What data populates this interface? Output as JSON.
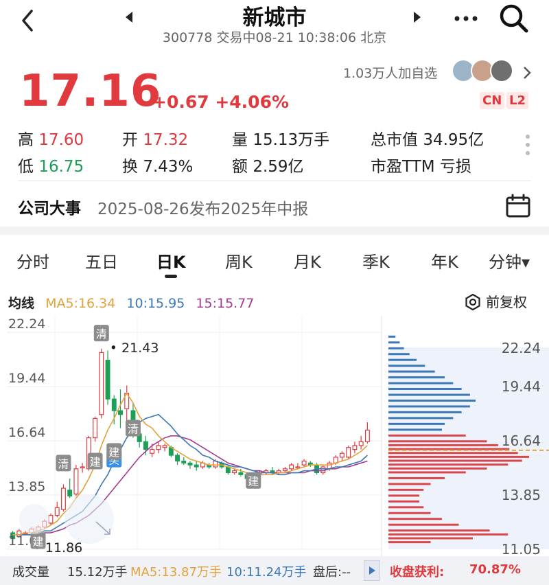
{
  "header": {
    "title": "新城市",
    "subtitle": "300778 交易中08-21 10:38:06 北京"
  },
  "quote": {
    "price": "17.16",
    "change": "+0.67 +4.06%",
    "followers": "1.03万人加自选",
    "tag_cn": "CN",
    "tag_l2": "L2"
  },
  "stats": {
    "high_label": "高",
    "high": "17.60",
    "open_label": "开",
    "open": "17.32",
    "vol_label": "量",
    "vol": "15.13万手",
    "mcap_label": "总市值",
    "mcap": "34.95亿",
    "low_label": "低",
    "low": "16.75",
    "turn_label": "换",
    "turn": "7.43%",
    "amt_label": "额",
    "amt": "2.59亿",
    "pe_label": "市盈TTM",
    "pe": "亏损"
  },
  "event": {
    "label": "公司大事",
    "text": "2025-08-26发布2025年中报"
  },
  "tabs": [
    "分时",
    "五日",
    "日K",
    "周K",
    "月K",
    "季K",
    "年K",
    "分钟▾"
  ],
  "active_tab": "日K",
  "ma": {
    "label": "均线",
    "ma5": "MA5:16.34",
    "ma10": "10:15.95",
    "ma15": "15:15.77",
    "fq_label": "前复权"
  },
  "colors": {
    "up": "#e0393e",
    "down": "#1c9f56",
    "ma5": "#e2a23b",
    "ma10": "#3b78b7",
    "ma15": "#a33a8f",
    "profile_up": "#d9464b",
    "profile_down": "#3b78b7"
  },
  "chart_data": {
    "type": "candlestick",
    "y_ticks_left": [
      "22.24",
      "19.44",
      "16.64",
      "13.85",
      "11.05"
    ],
    "y_ticks_right": [
      "22.24",
      "19.44",
      "16.64",
      "13.85",
      "11.05"
    ],
    "ylim": [
      11.05,
      22.24
    ],
    "max_label": "21.43",
    "min_label": "11.86",
    "markers": [
      "清",
      "建",
      "清",
      "建",
      "买",
      "清",
      "建",
      "建"
    ],
    "candles": [
      {
        "o": 11.9,
        "c": 11.6,
        "h": 12.0,
        "l": 11.4
      },
      {
        "o": 11.7,
        "c": 12.0,
        "h": 12.1,
        "l": 11.7
      },
      {
        "o": 11.9,
        "c": 11.9,
        "h": 12.0,
        "l": 11.8
      },
      {
        "o": 11.9,
        "c": 12.1,
        "h": 12.2,
        "l": 11.8
      },
      {
        "o": 12.0,
        "c": 12.2,
        "h": 12.3,
        "l": 11.9
      },
      {
        "o": 12.2,
        "c": 12.5,
        "h": 12.6,
        "l": 12.1
      },
      {
        "o": 12.4,
        "c": 12.8,
        "h": 12.9,
        "l": 12.3
      },
      {
        "o": 12.8,
        "c": 13.2,
        "h": 13.5,
        "l": 12.7
      },
      {
        "o": 13.1,
        "c": 14.2,
        "h": 14.4,
        "l": 13.0
      },
      {
        "o": 14.1,
        "c": 13.8,
        "h": 14.7,
        "l": 13.7
      },
      {
        "o": 13.9,
        "c": 15.2,
        "h": 15.4,
        "l": 13.8
      },
      {
        "o": 15.3,
        "c": 15.3,
        "h": 15.5,
        "l": 15.0
      },
      {
        "o": 15.2,
        "c": 16.8,
        "h": 16.9,
        "l": 15.1
      },
      {
        "o": 16.8,
        "c": 17.8,
        "h": 17.9,
        "l": 16.6
      },
      {
        "o": 18.0,
        "c": 21.2,
        "h": 21.4,
        "l": 17.8
      },
      {
        "o": 20.8,
        "c": 18.8,
        "h": 21.3,
        "l": 18.5
      },
      {
        "o": 18.8,
        "c": 18.2,
        "h": 19.0,
        "l": 17.5
      },
      {
        "o": 18.2,
        "c": 18.0,
        "h": 19.3,
        "l": 17.3
      },
      {
        "o": 18.3,
        "c": 19.1,
        "h": 19.5,
        "l": 17.5
      },
      {
        "o": 18.2,
        "c": 17.3,
        "h": 18.6,
        "l": 16.8
      },
      {
        "o": 17.0,
        "c": 16.6,
        "h": 17.5,
        "l": 16.3
      },
      {
        "o": 16.6,
        "c": 16.2,
        "h": 16.9,
        "l": 15.9
      },
      {
        "o": 16.0,
        "c": 16.2,
        "h": 16.5,
        "l": 15.8
      },
      {
        "o": 16.2,
        "c": 16.4,
        "h": 16.6,
        "l": 16.0
      },
      {
        "o": 16.3,
        "c": 16.4,
        "h": 16.5,
        "l": 16.1
      },
      {
        "o": 16.3,
        "c": 15.9,
        "h": 16.4,
        "l": 15.8
      },
      {
        "o": 15.9,
        "c": 15.6,
        "h": 16.0,
        "l": 15.4
      },
      {
        "o": 15.6,
        "c": 15.5,
        "h": 15.8,
        "l": 15.4
      },
      {
        "o": 15.5,
        "c": 15.4,
        "h": 15.6,
        "l": 15.2
      },
      {
        "o": 15.4,
        "c": 15.3,
        "h": 15.6,
        "l": 15.1
      },
      {
        "o": 15.3,
        "c": 15.5,
        "h": 15.6,
        "l": 15.2
      },
      {
        "o": 15.4,
        "c": 15.3,
        "h": 15.5,
        "l": 15.2
      },
      {
        "o": 15.3,
        "c": 15.6,
        "h": 15.7,
        "l": 15.2
      },
      {
        "o": 15.5,
        "c": 15.3,
        "h": 15.6,
        "l": 15.2
      },
      {
        "o": 15.3,
        "c": 15.0,
        "h": 15.4,
        "l": 14.9
      },
      {
        "o": 15.0,
        "c": 15.1,
        "h": 15.2,
        "l": 14.9
      },
      {
        "o": 15.0,
        "c": 14.9,
        "h": 15.2,
        "l": 14.8
      },
      {
        "o": 14.9,
        "c": 14.7,
        "h": 15.0,
        "l": 14.6
      },
      {
        "o": 14.7,
        "c": 14.9,
        "h": 15.0,
        "l": 14.6
      },
      {
        "o": 14.9,
        "c": 15.0,
        "h": 15.1,
        "l": 14.8
      },
      {
        "o": 15.0,
        "c": 15.1,
        "h": 15.2,
        "l": 14.9
      },
      {
        "o": 15.1,
        "c": 15.0,
        "h": 15.3,
        "l": 14.9
      },
      {
        "o": 15.0,
        "c": 15.1,
        "h": 15.2,
        "l": 14.9
      },
      {
        "o": 15.1,
        "c": 15.2,
        "h": 15.3,
        "l": 15.0
      },
      {
        "o": 15.2,
        "c": 15.4,
        "h": 15.5,
        "l": 15.1
      },
      {
        "o": 15.3,
        "c": 15.3,
        "h": 15.5,
        "l": 15.2
      },
      {
        "o": 15.4,
        "c": 15.6,
        "h": 15.7,
        "l": 15.3
      },
      {
        "o": 15.5,
        "c": 15.4,
        "h": 15.6,
        "l": 15.3
      },
      {
        "o": 15.4,
        "c": 15.0,
        "h": 15.5,
        "l": 14.9
      },
      {
        "o": 15.0,
        "c": 15.3,
        "h": 15.4,
        "l": 14.9
      },
      {
        "o": 15.2,
        "c": 15.5,
        "h": 15.6,
        "l": 15.1
      },
      {
        "o": 15.5,
        "c": 15.8,
        "h": 15.9,
        "l": 15.4
      },
      {
        "o": 15.8,
        "c": 16.0,
        "h": 16.1,
        "l": 15.6
      },
      {
        "o": 15.8,
        "c": 16.3,
        "h": 16.4,
        "l": 15.7
      },
      {
        "o": 16.2,
        "c": 16.4,
        "h": 16.6,
        "l": 16.0
      },
      {
        "o": 16.4,
        "c": 16.6,
        "h": 16.9,
        "l": 16.2
      },
      {
        "o": 16.6,
        "c": 17.2,
        "h": 17.6,
        "l": 16.5
      }
    ],
    "ma5": [
      11.8,
      11.8,
      11.9,
      11.9,
      12.0,
      12.1,
      12.3,
      12.5,
      12.9,
      13.2,
      13.7,
      14.1,
      14.7,
      15.4,
      16.4,
      17.2,
      17.8,
      18.5,
      19.1,
      18.6,
      17.9,
      17.5,
      17.3,
      16.9,
      16.6,
      16.3,
      16.1,
      15.9,
      15.7,
      15.6,
      15.5,
      15.4,
      15.4,
      15.4,
      15.3,
      15.2,
      15.1,
      15.0,
      14.9,
      14.9,
      14.9,
      14.9,
      15.0,
      15.0,
      15.1,
      15.2,
      15.3,
      15.4,
      15.4,
      15.4,
      15.4,
      15.5,
      15.6,
      15.7,
      15.9,
      16.1,
      16.4
    ],
    "ma10": [
      11.8,
      11.8,
      11.8,
      11.8,
      11.9,
      12.0,
      12.0,
      12.2,
      12.4,
      12.6,
      12.8,
      13.0,
      13.4,
      13.8,
      14.4,
      14.9,
      15.6,
      16.2,
      16.8,
      17.2,
      17.6,
      17.8,
      17.9,
      18.0,
      17.7,
      17.4,
      17.0,
      16.7,
      16.4,
      16.2,
      15.9,
      15.8,
      15.6,
      15.5,
      15.4,
      15.3,
      15.3,
      15.2,
      15.1,
      15.0,
      15.0,
      15.0,
      14.9,
      14.9,
      15.0,
      15.0,
      15.1,
      15.1,
      15.2,
      15.2,
      15.2,
      15.3,
      15.3,
      15.4,
      15.5,
      15.6,
      15.9
    ],
    "ma15": [
      11.8,
      11.8,
      11.8,
      11.8,
      11.8,
      11.9,
      11.9,
      12.0,
      12.1,
      12.3,
      12.4,
      12.6,
      12.8,
      13.1,
      13.4,
      13.8,
      14.2,
      14.6,
      15.0,
      15.4,
      15.8,
      16.1,
      16.4,
      16.6,
      16.8,
      16.9,
      16.9,
      16.8,
      16.7,
      16.5,
      16.3,
      16.1,
      15.9,
      15.7,
      15.5,
      15.4,
      15.3,
      15.2,
      15.1,
      15.1,
      15.0,
      15.0,
      15.0,
      15.0,
      15.0,
      15.0,
      15.0,
      15.1,
      15.1,
      15.1,
      15.2,
      15.2,
      15.3,
      15.3,
      15.4,
      15.5,
      15.6
    ],
    "profile": [
      {
        "p": 22.0,
        "w": 0.05
      },
      {
        "p": 21.7,
        "w": 0.08
      },
      {
        "p": 21.4,
        "w": 0.11
      },
      {
        "p": 21.1,
        "w": 0.15
      },
      {
        "p": 20.8,
        "w": 0.2
      },
      {
        "p": 20.5,
        "w": 0.26
      },
      {
        "p": 20.2,
        "w": 0.33
      },
      {
        "p": 19.9,
        "w": 0.4
      },
      {
        "p": 19.6,
        "w": 0.46
      },
      {
        "p": 19.3,
        "w": 0.52
      },
      {
        "p": 19.0,
        "w": 0.58
      },
      {
        "p": 18.7,
        "w": 0.62
      },
      {
        "p": 18.4,
        "w": 0.58
      },
      {
        "p": 18.1,
        "w": 0.52
      },
      {
        "p": 17.8,
        "w": 0.46
      },
      {
        "p": 17.5,
        "w": 0.4
      },
      {
        "p": 17.2,
        "w": 0.38
      },
      {
        "p": 16.9,
        "w": 0.55
      },
      {
        "p": 16.6,
        "w": 0.7
      },
      {
        "p": 16.4,
        "w": 0.78
      },
      {
        "p": 16.2,
        "w": 0.86
      },
      {
        "p": 16.0,
        "w": 0.92
      },
      {
        "p": 15.8,
        "w": 1.0
      },
      {
        "p": 15.6,
        "w": 0.95
      },
      {
        "p": 15.4,
        "w": 0.85
      },
      {
        "p": 15.2,
        "w": 0.7
      },
      {
        "p": 15.0,
        "w": 0.55
      },
      {
        "p": 14.7,
        "w": 0.4
      },
      {
        "p": 14.4,
        "w": 0.3
      },
      {
        "p": 14.1,
        "w": 0.25
      },
      {
        "p": 13.8,
        "w": 0.22
      },
      {
        "p": 13.5,
        "w": 0.22
      },
      {
        "p": 13.2,
        "w": 0.25
      },
      {
        "p": 12.9,
        "w": 0.3
      },
      {
        "p": 12.6,
        "w": 0.38
      },
      {
        "p": 12.3,
        "w": 0.5
      },
      {
        "p": 12.0,
        "w": 0.72
      },
      {
        "p": 11.8,
        "w": 0.85
      },
      {
        "p": 11.6,
        "w": 0.6
      },
      {
        "p": 11.4,
        "w": 0.3
      }
    ],
    "current_price": 16.16
  },
  "volume": {
    "label": "成交量",
    "total": "15.12万手",
    "ma5": "MA5:13.87万手",
    "ma10": "10:11.24万手",
    "after": "盘后:--",
    "profit_label": "收盘获利:",
    "profit": "70.87%"
  }
}
